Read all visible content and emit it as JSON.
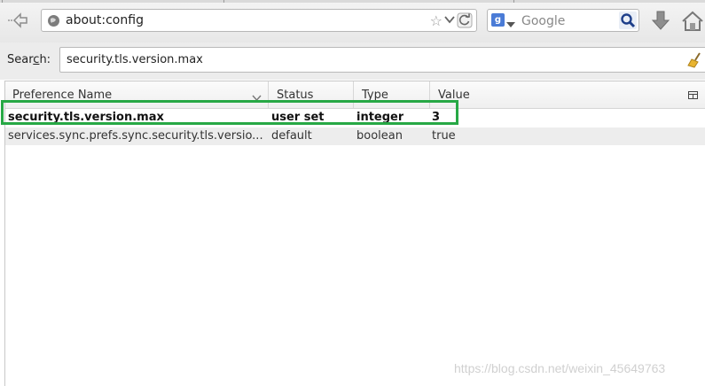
{
  "toolbar": {
    "url": "about:config",
    "search_placeholder": "Google",
    "search_engine_letter": "g"
  },
  "filter": {
    "label_prefix": "Sear",
    "label_accel": "c",
    "label_suffix": "h:",
    "value": "security.tls.version.max"
  },
  "columns": {
    "name": "Preference Name",
    "status": "Status",
    "type": "Type",
    "value": "Value"
  },
  "rows": [
    {
      "name": "security.tls.version.max",
      "status": "user set",
      "type": "integer",
      "value": "3"
    },
    {
      "name": "services.sync.prefs.sync.security.tls.versio...",
      "status": "default",
      "type": "boolean",
      "value": "true"
    }
  ],
  "watermark": "https://blog.csdn.net/weixin_45649763",
  "colors": {
    "highlight": "#27a845",
    "row_alt": "#ededed"
  }
}
